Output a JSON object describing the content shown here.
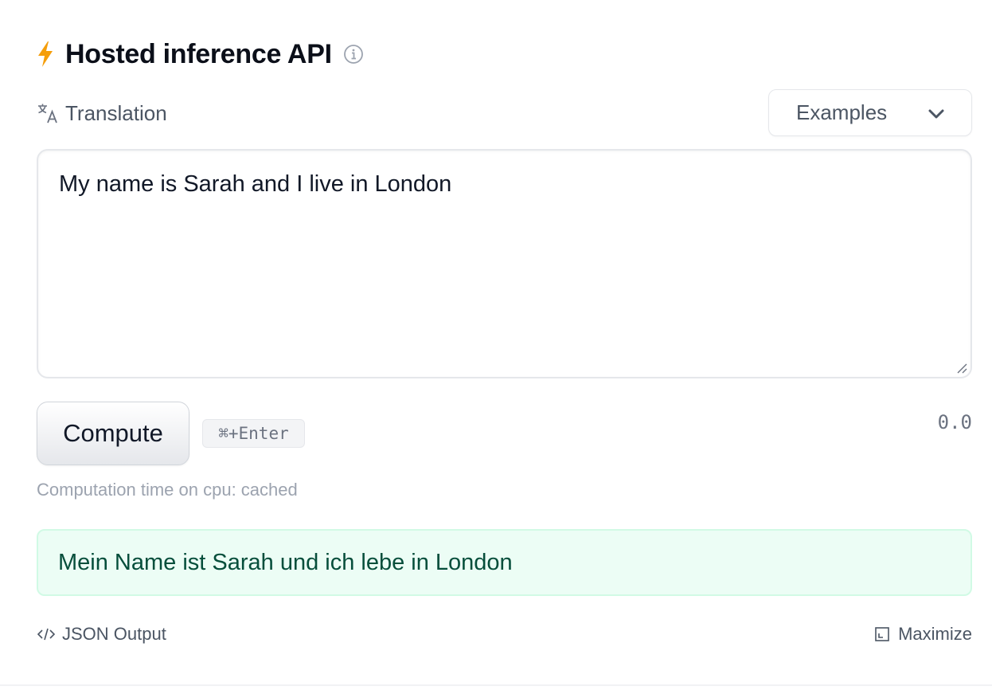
{
  "header": {
    "title": "Hosted inference API",
    "bolt_icon": "lightning-bolt-icon",
    "info_icon": "info-icon",
    "accent_color": "#f59e0b"
  },
  "task": {
    "label": "Translation",
    "icon": "translate-icon"
  },
  "examples_dropdown": {
    "label": "Examples",
    "icon": "chevron-down-icon"
  },
  "input": {
    "value": "My name is Sarah and I live in London"
  },
  "compute": {
    "button_label": "Compute",
    "shortcut": "⌘+Enter",
    "score": "0.0"
  },
  "status": {
    "computation_time": "Computation time on cpu: cached"
  },
  "output": {
    "text": "Mein Name ist Sarah und ich lebe in London",
    "background_color": "#ecfdf5",
    "text_color": "#064e3b"
  },
  "footer": {
    "json_output_label": "JSON Output",
    "json_output_icon": "code-icon",
    "maximize_label": "Maximize",
    "maximize_icon": "maximize-icon"
  }
}
